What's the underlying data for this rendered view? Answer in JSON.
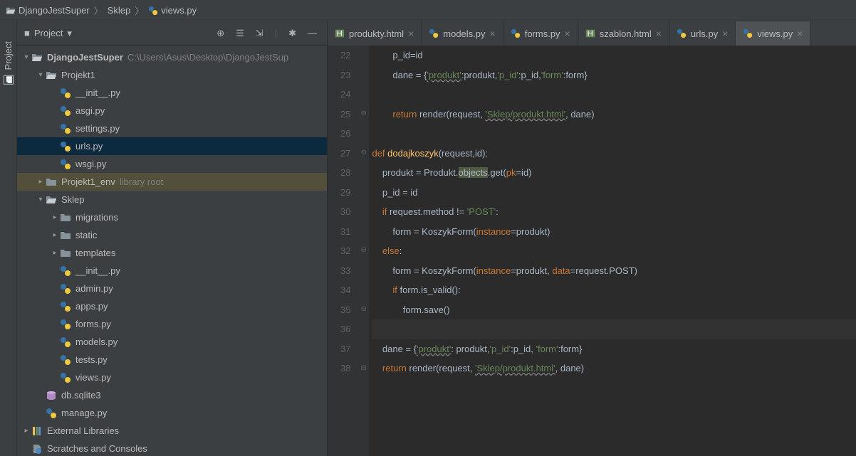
{
  "breadcrumb": {
    "root": "DjangoJestSuper",
    "mid": "Sklep",
    "file": "views.py"
  },
  "toolStripe": {
    "project": "Project"
  },
  "sidebar": {
    "title": "Project",
    "tree": {
      "root": {
        "name": "DjangoJestSuper",
        "hint": "C:\\Users\\Asus\\Desktop\\DjangoJestSup"
      },
      "projekt1": "Projekt1",
      "init": "__init__.py",
      "asgi": "asgi.py",
      "settings": "settings.py",
      "urls": "urls.py",
      "wsgi": "wsgi.py",
      "env": "Projekt1_env",
      "envHint": "library root",
      "sklep": "Sklep",
      "migrations": "migrations",
      "static": "static",
      "templates": "templates",
      "s_init": "__init__.py",
      "s_admin": "admin.py",
      "s_apps": "apps.py",
      "s_forms": "forms.py",
      "s_models": "models.py",
      "s_tests": "tests.py",
      "s_views": "views.py",
      "db": "db.sqlite3",
      "manage": "manage.py",
      "extlib": "External Libraries",
      "scratch": "Scratches and Consoles"
    }
  },
  "tabs": [
    {
      "label": "produkty.html",
      "type": "html"
    },
    {
      "label": "models.py",
      "type": "py"
    },
    {
      "label": "forms.py",
      "type": "py"
    },
    {
      "label": "szablon.html",
      "type": "html"
    },
    {
      "label": "urls.py",
      "type": "py"
    },
    {
      "label": "views.py",
      "type": "py",
      "active": true
    }
  ],
  "code": {
    "first": 22,
    "lines": [
      "        p_id=id",
      "        dane = {'produkt':produkt,'p_id':p_id,'form':form}",
      "",
      "        return render(request, 'Sklep/produkt.html', dane)",
      "",
      "def dodajkoszyk(request,id):",
      "    produkt = Produkt.objects.get(pk=id)",
      "    p_id = id",
      "    if request.method != 'POST':",
      "        form = KoszykForm(instance=produkt)",
      "    else:",
      "        form = KoszykForm(instance=produkt, data=request.POST)",
      "        if form.is_valid():",
      "            form.save()",
      "",
      "    dane = {'produkt': produkt,'p_id':p_id, 'form':form}",
      "    return render(request, 'Sklep/produkt.html', dane)"
    ]
  }
}
